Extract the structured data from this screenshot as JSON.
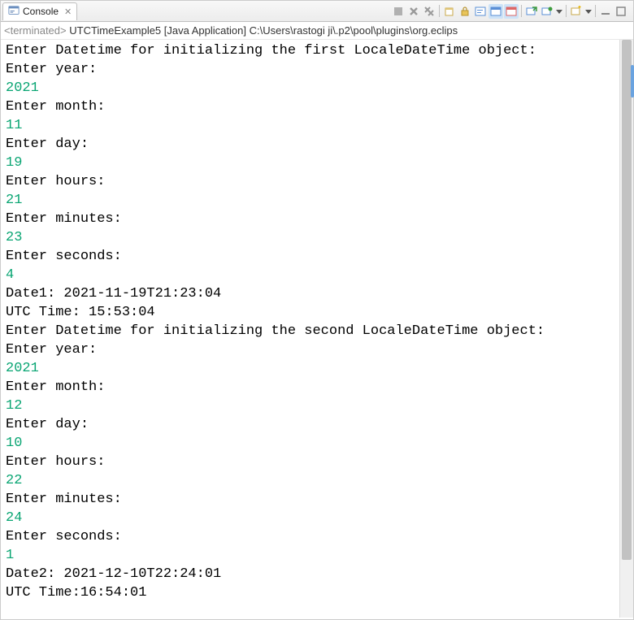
{
  "tab": {
    "title": "Console"
  },
  "status": {
    "state": "<terminated>",
    "classname": "UTCTimeExample5",
    "runtype": "[Java Application]",
    "path": "C:\\Users\\rastogi ji\\.p2\\pool\\plugins\\org.eclips"
  },
  "console": {
    "lines": [
      {
        "t": "Enter Datetime for initializing the first LocaleDateTime object:",
        "c": "p"
      },
      {
        "t": "Enter year:",
        "c": "p"
      },
      {
        "t": "2021",
        "c": "inp"
      },
      {
        "t": "Enter month:",
        "c": "p"
      },
      {
        "t": "11",
        "c": "inp"
      },
      {
        "t": "Enter day:",
        "c": "p"
      },
      {
        "t": "19",
        "c": "inp"
      },
      {
        "t": "Enter hours:",
        "c": "p"
      },
      {
        "t": "21",
        "c": "inp"
      },
      {
        "t": "Enter minutes:",
        "c": "p"
      },
      {
        "t": "23",
        "c": "inp"
      },
      {
        "t": "Enter seconds:",
        "c": "p"
      },
      {
        "t": "4",
        "c": "inp"
      },
      {
        "t": "Date1: 2021-11-19T21:23:04",
        "c": "p"
      },
      {
        "t": "UTC Time: 15:53:04",
        "c": "p"
      },
      {
        "t": "Enter Datetime for initializing the second LocaleDateTime object:",
        "c": "p"
      },
      {
        "t": "Enter year:",
        "c": "p"
      },
      {
        "t": "2021",
        "c": "inp"
      },
      {
        "t": "Enter month:",
        "c": "p"
      },
      {
        "t": "12",
        "c": "inp"
      },
      {
        "t": "Enter day:",
        "c": "p"
      },
      {
        "t": "10",
        "c": "inp"
      },
      {
        "t": "Enter hours:",
        "c": "p"
      },
      {
        "t": "22",
        "c": "inp"
      },
      {
        "t": "Enter minutes:",
        "c": "p"
      },
      {
        "t": "24",
        "c": "inp"
      },
      {
        "t": "Enter seconds:",
        "c": "p"
      },
      {
        "t": "1",
        "c": "inp"
      },
      {
        "t": "Date2: 2021-12-10T22:24:01",
        "c": "p"
      },
      {
        "t": "UTC Time:16:54:01",
        "c": "p"
      }
    ]
  },
  "icons": {
    "console": "console-icon",
    "stop_gray": "stop-icon",
    "remove_gray": "remove-launch-icon",
    "remove_all_gray": "remove-all-launches-icon",
    "clear": "clear-console-icon",
    "lock": "scroll-lock-icon",
    "word_wrap": "word-wrap-icon",
    "show_out": "show-stdout-icon",
    "show_err": "show-stderr-icon",
    "open_console": "open-console-icon",
    "pin": "pin-console-icon",
    "drop_arrow": "dropdown-arrow-icon",
    "new_console": "new-console-icon",
    "minimize": "minimize-icon",
    "maximize": "maximize-icon"
  }
}
